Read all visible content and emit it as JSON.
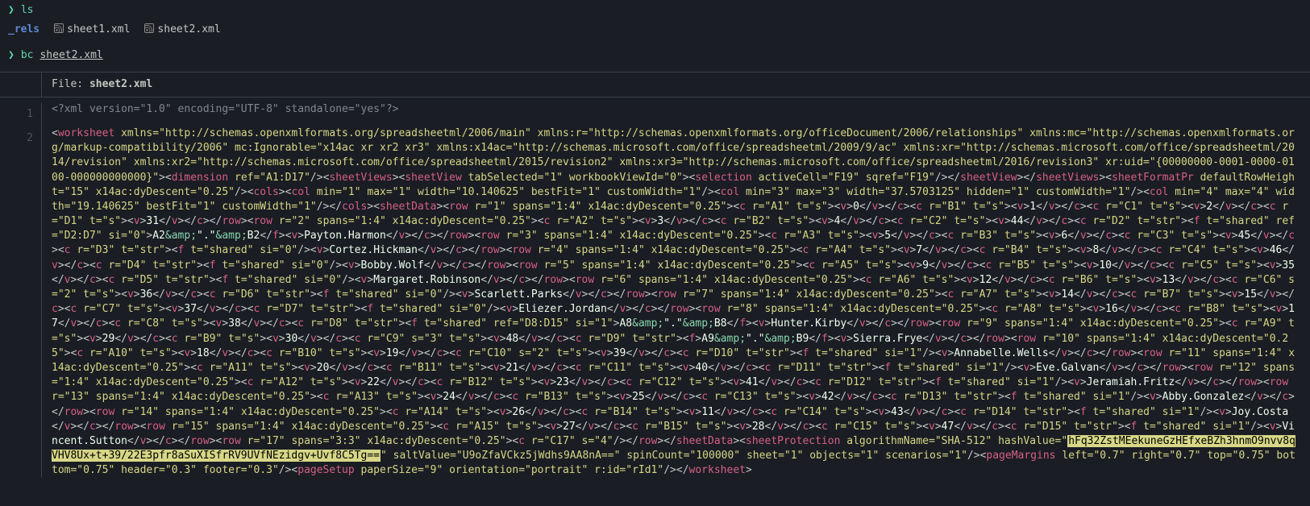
{
  "cmds": {
    "ls": "ls",
    "bc": "bc",
    "bc_arg": "sheet2.xml"
  },
  "ls_out": {
    "dir": "_rels",
    "f1": "sheet1.xml",
    "f2": "sheet2.xml"
  },
  "file_header": {
    "label": "File:",
    "name": "sheet2.xml"
  },
  "gutter": {
    "l1": "1",
    "l2": "2"
  },
  "xml": {
    "pi": "<?xml version=\"1.0\" encoding=\"UTF-8\" standalone=\"yes\"?>",
    "ws_open": "worksheet",
    "ns_main": "xmlns=\"http://schemas.openxmlformats.org/spreadsheetml/2006/main\"",
    "ns_r": "xmlns:r=\"http://schemas.openxmlformats.org/officeDocument/2006/relationships\"",
    "ns_mc": "xmlns:mc=\"http://schemas.openxmlformats.org/markup-compatibility/2006\"",
    "mc_ig": "mc:Ignorable=\"x14ac xr xr2 xr3\"",
    "ns_x14ac": "xmlns:x14ac=\"http://schemas.microsoft.com/office/spreadsheetml/2009/9/ac\"",
    "ns_xr": "xmlns:xr=\"http://schemas.microsoft.com/office/spreadsheetml/2014/revision\"",
    "ns_xr2": "xmlns:xr2=\"http://schemas.microsoft.com/office/spreadsheetml/2015/revision2\"",
    "ns_xr3": "xmlns:xr3=\"http://schemas.microsoft.com/office/spreadsheetml/2016/revision3\"",
    "xr_uid": "xr:uid=\"{00000000-0001-0000-0100-000000000000}\"",
    "dim": "dimension",
    "dim_ref": "ref=\"A1:D17\"",
    "sheetViews": "sheetViews",
    "sheetView": "sheetView",
    "sv_attrs": "tabSelected=\"1\" workbookViewId=\"0\"",
    "selection": "selection",
    "sel_attrs": "activeCell=\"F19\" sqref=\"F19\"",
    "sfpr": "sheetFormatPr",
    "sfpr_attrs": "defaultRowHeight=\"15\" x14ac:dyDescent=\"0.25\"",
    "cols": "cols",
    "col": "col",
    "col1": "min=\"1\" max=\"1\" width=\"10.140625\" bestFit=\"1\" customWidth=\"1\"",
    "col3": "min=\"3\" max=\"3\" width=\"37.5703125\" hidden=\"1\" customWidth=\"1\"",
    "col4": "min=\"4\" max=\"4\" width=\"19.140625\" bestFit=\"1\" customWidth=\"1\"",
    "sheetData": "sheetData",
    "row": "row",
    "c": "c",
    "v": "v",
    "f": "f",
    "row1": "r=\"1\" spans=\"1:4\" x14ac:dyDescent=\"0.25\"",
    "row2": "r=\"2\" spans=\"1:4\" x14ac:dyDescent=\"0.25\"",
    "row3": "r=\"3\" spans=\"1:4\" x14ac:dyDescent=\"0.25\"",
    "row4": "r=\"4\" spans=\"1:4\" x14ac:dyDescent=\"0.25\"",
    "row5": "r=\"5\" spans=\"1:4\" x14ac:dyDescent=\"0.25\"",
    "row6": "r=\"6\" spans=\"1:4\" x14ac:dyDescent=\"0.25\"",
    "row7": "r=\"7\" spans=\"1:4\" x14ac:dyDescent=\"0.25\"",
    "row8": "r=\"8\" spans=\"1:4\" x14ac:dyDescent=\"0.25\"",
    "row9": "r=\"9\" spans=\"1:4\" x14ac:dyDescent=\"0.25\"",
    "row10": "r=\"10\" spans=\"1:4\" x14ac:dyDescent=\"0.25\"",
    "row11": "r=\"11\" spans=\"1:4\" x14ac:dyDescent=\"0.25\"",
    "row12": "r=\"12\" spans=\"1:4\" x14ac:dyDescent=\"0.25\"",
    "row13": "r=\"13\" spans=\"1:4\" x14ac:dyDescent=\"0.25\"",
    "row14": "r=\"14\" spans=\"1:4\" x14ac:dyDescent=\"0.25\"",
    "row15": "r=\"15\" spans=\"1:4\" x14ac:dyDescent=\"0.25\"",
    "row17": "r=\"17\" spans=\"3:3\" x14ac:dyDescent=\"0.25\"",
    "A1": "r=\"A1\" t=\"s\"",
    "vA1": "0",
    "B1": "r=\"B1\" t=\"s\"",
    "vB1": "1",
    "C1": "r=\"C1\" t=\"s\"",
    "vC1": "2",
    "D1": "r=\"D1\" t=\"s\"",
    "vD1": "31",
    "A2": "r=\"A2\" t=\"s\"",
    "vA2": "3",
    "B2": "r=\"B2\" t=\"s\"",
    "vB2": "4",
    "C2": "r=\"C2\" t=\"s\"",
    "vC2": "44",
    "D2": "r=\"D2\" t=\"str\"",
    "fD2_attrs": "t=\"shared\" ref=\"D2:D7\" si=\"0\"",
    "fD2_txt1": "A2",
    "fD2_amp1": "&amp;",
    "fD2_txt2": "\".\"",
    "fD2_amp2": "&amp;",
    "fD2_txt3": "B2",
    "vD2": "Payton.Harmon",
    "A3": "r=\"A3\" t=\"s\"",
    "vA3": "5",
    "B3": "r=\"B3\" t=\"s\"",
    "vB3": "6",
    "C3": "r=\"C3\" t=\"s\"",
    "vC3": "45",
    "D3": "r=\"D3\" t=\"str\"",
    "fD3": "t=\"shared\" si=\"0\"",
    "vD3": "Cortez.Hickman",
    "A4": "r=\"A4\" t=\"s\"",
    "vA4": "7",
    "B4": "r=\"B4\" t=\"s\"",
    "vB4": "8",
    "C4": "r=\"C4\" t=\"s\"",
    "vC4": "46",
    "D4": "r=\"D4\" t=\"str\"",
    "fD4": "t=\"shared\" si=\"0\"",
    "vD4": "Bobby.Wolf",
    "A5": "r=\"A5\" t=\"s\"",
    "vA5": "9",
    "B5": "r=\"B5\" t=\"s\"",
    "vB5": "10",
    "C5": "r=\"C5\" t=\"s\"",
    "vC5": "35",
    "D5": "r=\"D5\" t=\"str\"",
    "fD5": "t=\"shared\" si=\"0\"",
    "vD5": "Margaret.Robinson",
    "A6": "r=\"A6\" t=\"s\"",
    "vA6": "12",
    "B6": "r=\"B6\" t=\"s\"",
    "vB6": "13",
    "C6": "r=\"C6\" s=\"2\" t=\"s\"",
    "vC6": "36",
    "D6": "r=\"D6\" t=\"str\"",
    "fD6": "t=\"shared\" si=\"0\"",
    "vD6": "Scarlett.Parks",
    "A7": "r=\"A7\" t=\"s\"",
    "vA7": "14",
    "B7": "r=\"B7\" t=\"s\"",
    "vB7": "15",
    "C7": "r=\"C7\" t=\"s\"",
    "vC7": "37",
    "D7": "r=\"D7\" t=\"str\"",
    "fD7": "t=\"shared\" si=\"0\"",
    "vD7": "Eliezer.Jordan",
    "A8": "r=\"A8\" t=\"s\"",
    "vA8": "16",
    "B8": "r=\"B8\" t=\"s\"",
    "vB8": "17",
    "C8": "r=\"C8\" t=\"s\"",
    "vC8": "38",
    "D8": "r=\"D8\" t=\"str\"",
    "fD8_attrs": "t=\"shared\" ref=\"D8:D15\" si=\"1\"",
    "fD8_txt1": "A8",
    "fD8_amp1": "&amp;",
    "fD8_txt2": "\".\"",
    "fD8_amp2": "&amp;",
    "fD8_txt3": "B8",
    "vD8": "Hunter.Kirby",
    "A9": "r=\"A9\" t=\"s\"",
    "vA9": "29",
    "B9": "r=\"B9\" t=\"s\"",
    "vB9": "30",
    "C9": "r=\"C9\" s=\"3\" t=\"s\"",
    "vC9": "48",
    "D9": "r=\"D9\" t=\"str\"",
    "fD9_txt1": "A9",
    "fD9_amp1": "&amp;",
    "fD9_txt2": "\".\"",
    "fD9_amp2": "&amp;",
    "fD9_txt3": "B9",
    "vD9": "Sierra.Frye",
    "A10": "r=\"A10\" t=\"s\"",
    "vA10": "18",
    "B10": "r=\"B10\" t=\"s\"",
    "vB10": "19",
    "C10": "r=\"C10\" s=\"2\" t=\"s\"",
    "vC10": "39",
    "D10": "r=\"D10\" t=\"str\"",
    "fD10": "t=\"shared\" si=\"1\"",
    "vD10": "Annabelle.Wells",
    "A11": "r=\"A11\" t=\"s\"",
    "vA11": "20",
    "B11": "r=\"B11\" t=\"s\"",
    "vB11": "21",
    "C11": "r=\"C11\" t=\"s\"",
    "vC11": "40",
    "D11": "r=\"D11\" t=\"str\"",
    "fD11": "t=\"shared\" si=\"1\"",
    "vD11": "Eve.Galvan",
    "A12": "r=\"A12\" t=\"s\"",
    "vA12": "22",
    "B12": "r=\"B12\" t=\"s\"",
    "vB12": "23",
    "C12": "r=\"C12\" t=\"s\"",
    "vC12": "41",
    "D12": "r=\"D12\" t=\"str\"",
    "fD12": "t=\"shared\" si=\"1\"",
    "vD12": "Jeramiah.Fritz",
    "A13": "r=\"A13\" t=\"s\"",
    "vA13": "24",
    "B13": "r=\"B13\" t=\"s\"",
    "vB13": "25",
    "C13": "r=\"C13\" t=\"s\"",
    "vC13": "42",
    "D13": "r=\"D13\" t=\"str\"",
    "fD13": "t=\"shared\" si=\"1\"",
    "vD13": "Abby.Gonzalez",
    "A14": "r=\"A14\" t=\"s\"",
    "vA14": "26",
    "B14": "r=\"B14\" t=\"s\"",
    "vB14": "11",
    "C14": "r=\"C14\" t=\"s\"",
    "vC14": "43",
    "D14": "r=\"D14\" t=\"str\"",
    "fD14": "t=\"shared\" si=\"1\"",
    "vD14": "Joy.Costa",
    "A15": "r=\"A15\" t=\"s\"",
    "vA15": "27",
    "B15": "r=\"B15\" t=\"s\"",
    "vB15": "28",
    "C15": "r=\"C15\" t=\"s\"",
    "vC15": "47",
    "D15": "r=\"D15\" t=\"str\"",
    "fD15": "t=\"shared\" si=\"1\"",
    "vD15": "Vincent.Sutton",
    "C17": "r=\"C17\" s=\"4\"",
    "sp": "sheetProtection",
    "sp_algo": "algorithmName=\"SHA-512\"",
    "sp_hash_k": "hashValue=\"",
    "sp_hash_v": "hFq32ZstMEekuneGzHEfxeBZh3hnmO9nvv8qVHV8Ux+t+39/22E3pfr8aSuXISfrRV9UVfNEzidgv+Uvf8C5Tg==",
    "sp_salt": "saltValue=\"U9oZfaVCkz5jWdhs9AA8nA==\"",
    "sp_spin": "spinCount=\"100000\"",
    "sp_flags": "sheet=\"1\" objects=\"1\" scenarios=\"1\"",
    "pm": "pageMargins",
    "pm_attrs": "left=\"0.7\" right=\"0.7\" top=\"0.75\" bottom=\"0.75\" header=\"0.3\" footer=\"0.3\"",
    "ps": "pageSetup",
    "ps_attrs": "paperSize=\"9\" orientation=\"portrait\" r:id=\"rId1\""
  }
}
